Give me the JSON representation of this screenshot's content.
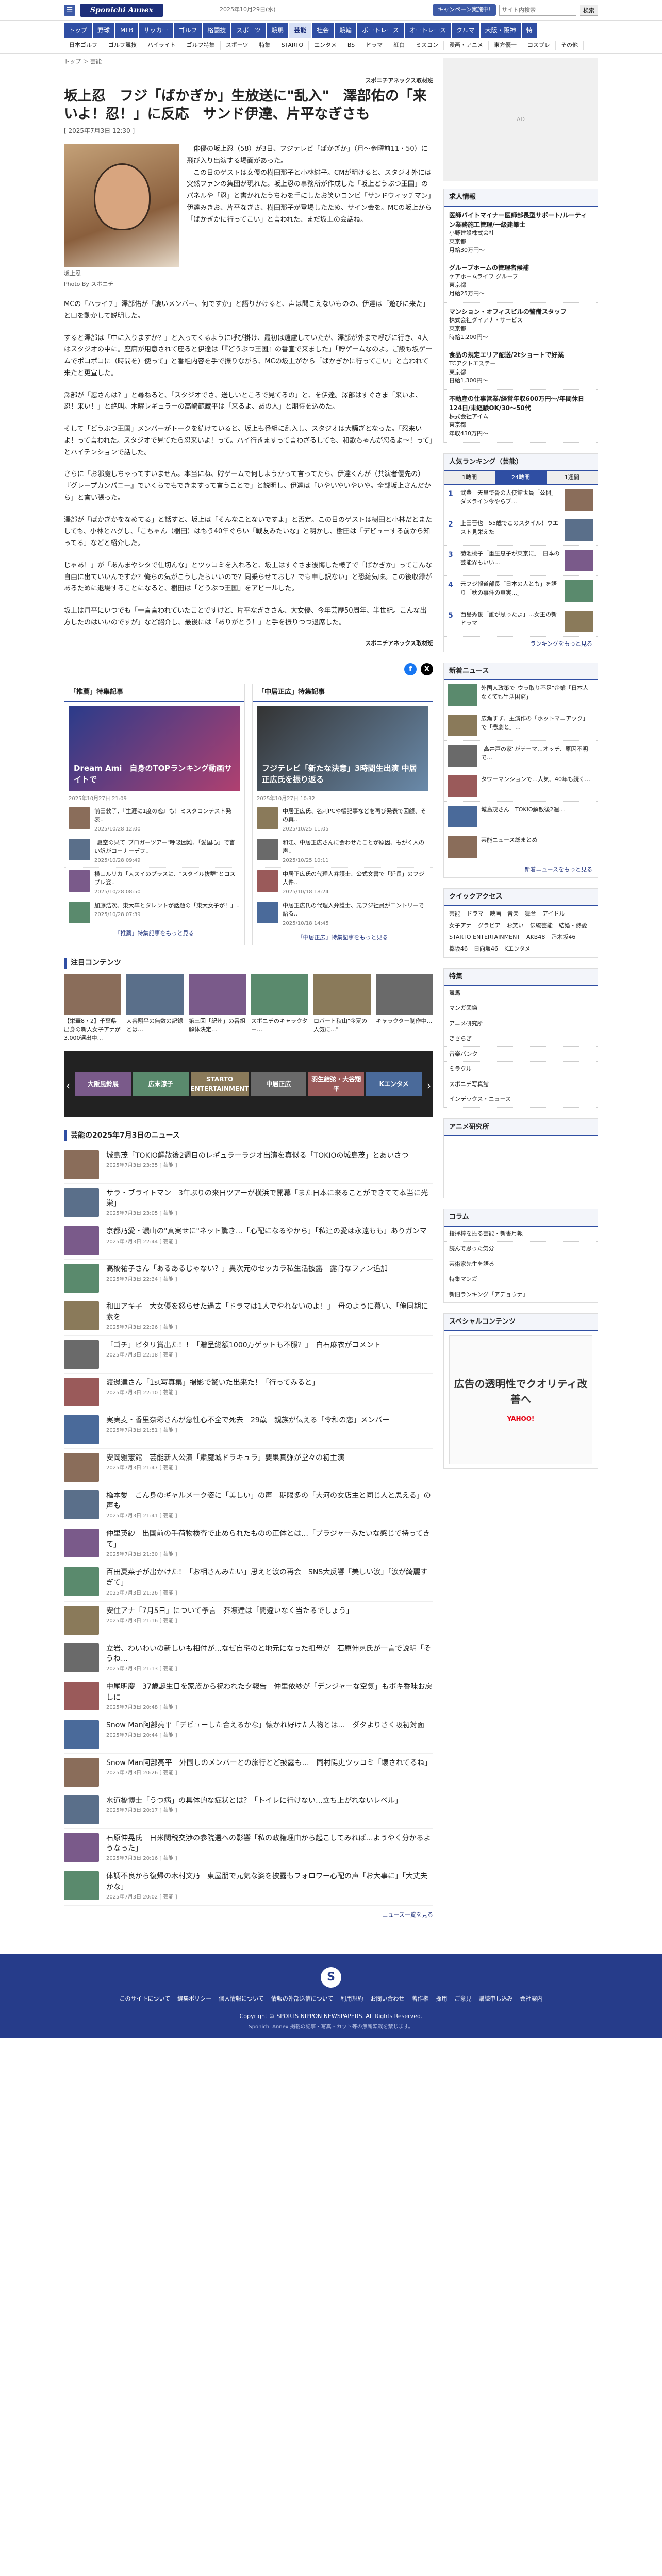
{
  "header": {
    "logo": "Sponichi Annex",
    "date": "2025年10月29日(水)",
    "promo": "キャンペーン実施中!",
    "search_placeholder": "サイト内検索",
    "search_button": "検索",
    "nav": [
      "トップ",
      "野球",
      "MLB",
      "サッカー",
      "ゴルフ",
      "格闘技",
      "スポーツ",
      "競馬",
      "芸能",
      "社会",
      "競輪",
      "ボートレース",
      "オートレース",
      "クルマ",
      "大阪・阪神",
      "特"
    ],
    "nav_active": "芸能",
    "subnav": [
      "日本ゴルフ",
      "ゴルフ競技",
      "ハイライト",
      "ゴルフ特集",
      "スポーツ",
      "特集",
      "STARTO",
      "エンタメ",
      "BS",
      "ドラマ",
      "紅白",
      "ミスコン",
      "漫画・アニメ",
      "東方優一",
      "コスプレ",
      "その他"
    ]
  },
  "article": {
    "breadcrumb": "トップ ＞ 芸能",
    "source": "スポニチアネックス取材班",
    "title": "坂上忍　フジ「ばかぎか」生放送に\"乱入\"　澤部佑の「来いよ！忍！」に反応　サンド伊達、片平なぎさも",
    "date": "[ 2025年7月3日 12:30 ]",
    "photo_caption": "坂上忍",
    "photo_credit": "Photo By スポニチ",
    "lead": "　俳優の坂上忍（58）が3日、フジテレビ「ぱかぎか」（月～金曜前11・50）に飛び入り出演する場面があった。\n　この日のゲストは女優の樹田那子と小林緋子。CMが明けると、スタジオ外には突然ファンの集団が現れた。坂上忍の事務所が作成した「坂上どうぶつ王国」のパネルや「忍」と書かれたうちわを手にしたお笑いコンビ「サンドウィッチマン」伊達みきお、片平なぎさ、樹田那子が登場したため、サイン会を。MCの坂上から「ばかぎかに行ってこい」と言われた、まだ坂上の会話ね。",
    "paragraphs": [
      "MCの「ハライチ」澤部佑が「凄いメンバー、何ですか」と語りかけると、声は聞こえないものの、伊達は「遊びに来た」と口を動かして説明した。",
      "すると澤部は「中に入りますか？」と入ってくるように呼び掛け、最初は遠慮していたが、澤部が外まで呼びに行き、4人はスタジオの中に。座席が用意されて座ると伊達は「『どうぶつ王国』の番宣で来ました」「貯ゲームなのよ。ご飯も坂ゲームでポコポコに（時間を）使って」と番組内容を手で振りながら、MCの坂上がから「ばかぎかに行ってこい」と言われて来たと更宣した。",
      "澤部が「忍さんは？」と尋ねると、「スタジオでさ、送しいところで見てるの」と、を伊達。澤部はすぐさま「来いよ、忍！来い！」と絶叫。木曜レギュラーの高崎範蔵平は「来るよ、あの人」と期待を込めた。",
      "そして「どうぶつ王国」メンバーがトークを続けていると、坂上も番組に乱入し、スタジオは大騒ぎとなった。「忍来いよ！って言われた。スタジオで見てたら忍来いよ！って。ハイ行きますって言わざるしても、和歌ちゃんが忍るよ〜！って」とハイテンションで話した。",
      "さらに「お邪魔しちゃってすいません。本当にね、貯ゲームで何しようかって言ってたら、伊達くんが（共演者優先の）『グレープカンパニー』でいくらでもできますって言うことで」と説明し、伊達は「いやいやいやいや。全部坂上さんだから」と言い張った。",
      "澤部が「ばかぎかをなめてる」と話すと、坂上は「そんなことないですよ」と否定。この日のゲストは樹田と小林だとまたしても、小林とハグし、「こちゃん（樹田）はもう40年ぐらい「戦友みたいな」と明かし、樹田は「デビューする前から知ってる」などと紹介した。",
      "じゃあ！」が「あんまやシタで仕切んな」とツッコミを入れると、坂上はすぐさま後悔した様子で「ばかぎか」ってこんな自由に出ていいんですか？俺らの気がこうしたらいいので？同乗らせておし？でも申し訳ない」と恐縮気味。この後収録があるために退場することになると、樹田は「どうぶつ王国」をアピールした。",
      "坂上は月平にいつでも「一言言われていたことですけど、片平なぎささん、大女優、今年芸歴50周年、半世紀。こんな出方したのはいいのですが」など紹介し、最後には「ありがとう！」と手を振りつつ退席した。"
    ],
    "footer_source": "スポニチアネックス取材班"
  },
  "specials": [
    {
      "title": "「推薦」特集記事",
      "feature": "Dream Ami　自身のTOPランキング動画サイトで",
      "feature_date": "2025年10月27日 21:09",
      "items": [
        {
          "t": "前田敦子、『生涯に1度の恋』も！ミスタコンテスト発表..",
          "d": "2025/10/28 12:00"
        },
        {
          "t": "\"夏空の果て\"ブロガーツアー\"呼吸困難、「愛国心」で言い訳がコーナーデフ..",
          "d": "2025/10/28 09:49"
        },
        {
          "t": "横山ルリカ「大スイのプラスに、\"スタイル抜群\"とコスプレ姿..",
          "d": "2025/10/28 08:50"
        },
        {
          "t": "加藤浩次、東大卒とタレントが話題の「東大女子が！」..",
          "d": "2025/10/28 07:39"
        }
      ],
      "more": "「推薦」特集記事をもっと見る"
    },
    {
      "title": "「中居正広」特集記事",
      "feature": "フジテレビ「新たな決意」3時間生出演 中居正広氏を振り返る",
      "feature_date": "2025年10月27日 10:32",
      "items": [
        {
          "t": "中居正広氏、名刺PCや帳記事などを再び発表で回顧、その真..",
          "d": "2025/10/25 11:05"
        },
        {
          "t": "和江、中居正広さんに会わせたことが原因、もがく人の声..",
          "d": "2025/10/25 10:11"
        },
        {
          "t": "中居正広氏の代理人弁護士、公式文書で「延長」のフジ人件..",
          "d": "2025/10/18 18:24"
        },
        {
          "t": "中居正広氏の代理人弁護士、元フジ社員がエントリーで語る..",
          "d": "2025/10/18 14:45"
        }
      ],
      "more": "「中居正広」特集記事をもっと見る"
    }
  ],
  "attention": {
    "title": "注目コンテンツ",
    "items": [
      "【栄華8・2】千葉県出身の新人女子アナが3,000選出中…",
      "大谷翔平の無数の記録とは…",
      "第三回「紀州」の番組解体決定…",
      "スポニチのキャラクター…",
      "ロバート秋山\"今夏の人気に...\"",
      "キャラクター制作中…"
    ],
    "carousel": [
      "大阪風鈴展",
      "広末涼子",
      "STARTO ENTERTAINMENT",
      "中居正広",
      "羽生結弦・大谷翔平",
      "Kエンタメ"
    ]
  },
  "latest": {
    "title": "芸能の2025年7月3日のニュース",
    "items": [
      {
        "t": "城島茂「TOKIO解散後2週目のレギュラーラジオ出演を真似る「TOKIOの城島茂」とあいさつ",
        "d": "2025年7月3日 23:35 [ 芸能 ]"
      },
      {
        "t": "サラ・ブライトマン　3年ぶりの来日ツアーが横浜で開幕「また日本に来ることができてて本当に光栄」",
        "d": "2025年7月3日 23:05 [ 芸能 ]"
      },
      {
        "t": "京都乃愛・濃山の\"真実せに\"ネット驚き…「心配になるやから」「私達の愛は永遠もも」ありガンマ",
        "d": "2025年7月3日 22:44 [ 芸能 ]"
      },
      {
        "t": "高橋祐子さん「あるあるじゃない？」異次元のセッカラ私生活披露　露骨なファン追加",
        "d": "2025年7月3日 22:34 [ 芸能 ]"
      },
      {
        "t": "和田アキ子　大女優を怒らせた過去「ドラマは1人でやれないのよ！」　母のように慕い、「俺同期に素を",
        "d": "2025年7月3日 22:26 [ 芸能 ]"
      },
      {
        "t": "「ゴチ」ビタリ賞出た！！「贈呈総額1000万ゲットも不服？」　白石麻衣がコメント",
        "d": "2025年7月3日 22:18 [ 芸能 ]"
      },
      {
        "t": "渡邊達さん「1st写真集」撮影で驚いた出来た！「行ってみると」",
        "d": "2025年7月3日 22:10 [ 芸能 ]"
      },
      {
        "t": "実実麦・香里奈彩さんが急性心不全で死去　29歳　親族が伝える「令和の恋」メンバー",
        "d": "2025年7月3日 21:51 [ 芸能 ]"
      },
      {
        "t": "安岡雅憲館　芸能新人公演「粛魔城ドラキュラ」要果真弥が堂々の初主演",
        "d": "2025年7月3日 21:47 [ 芸能 ]"
      },
      {
        "t": "橋本愛　こん身のギャルメーク姿に「美しい」の声　期限多の「大河の女店主と同じ人と思える」の声も",
        "d": "2025年7月3日 21:41 [ 芸能 ]"
      },
      {
        "t": "仲里英紗　出国前の手荷物検査で止められたものの正体とは…「ブラジャーみたいな感じで持ってきて」",
        "d": "2025年7月3日 21:30 [ 芸能 ]"
      },
      {
        "t": "百田夏菜子が出かけた！「お相さんみたい」思えと涙の再会　SNS大反響「美しい涙」「涙が綺麗すぎて」",
        "d": "2025年7月3日 21:26 [ 芸能 ]"
      },
      {
        "t": "安住アナ「7月5日」について予言　芥凛達は「間違いなく当たるでしょう」",
        "d": "2025年7月3日 21:16 [ 芸能 ]"
      },
      {
        "t": "立岩、わいわいの新しいも相付が…なぜ自宅のと地元になった祖母が　石原伸晃氏が一言で説明「そうね…",
        "d": "2025年7月3日 21:13 [ 芸能 ]"
      },
      {
        "t": "中尾明慶　37歳誕生日を家族から祝われた夕報告　仲里依紗が「デンジャーな空気」もボキ香味お戻しに",
        "d": "2025年7月3日 20:48 [ 芸能 ]"
      },
      {
        "t": "Snow Man阿部亮平「デビューした合えるかな」懐かれ好けた人物とは…　ダタよりさく吸初対面",
        "d": "2025年7月3日 20:44 [ 芸能 ]"
      },
      {
        "t": "Snow Man阿部亮平　外国しのメンバーとの旅行とど披露も…　同村陽史ツッコミ「壊されてるね」",
        "d": "2025年7月3日 20:26 [ 芸能 ]"
      },
      {
        "t": "水道橋博士「うつ病」の具体的な症状とは？「トイレに行けない…立ち上がれないレベル」",
        "d": "2025年7月3日 20:17 [ 芸能 ]"
      },
      {
        "t": "石原伸晃氏　日米関税交渉の参院選への影響「私の政権理由から起こしてみれば…ようやく分かるようなった」",
        "d": "2025年7月3日 20:16 [ 芸能 ]"
      },
      {
        "t": "体調不良から復帰の木村文乃　東屋朋で元気な姿を披露もフォロワー心配の声「お大事に」「大丈夫かな」",
        "d": "2025年7月3日 20:02 [ 芸能 ]"
      }
    ],
    "more": "ニュース一覧を見る"
  },
  "sidebar": {
    "jobs_title": "求人情報",
    "jobs": [
      {
        "n": "医師バイトマイナー医師部長型サポート/ルーティン業務施工管理/一級建築士",
        "c": "小野建設株式会社",
        "p": "東京都",
        "s": "月給30万円〜"
      },
      {
        "n": "グループホームの管理者候補",
        "c": "ケアホームライフ グループ",
        "p": "東京都",
        "s": "月給25万円〜"
      },
      {
        "n": "マンション・オフィスビルの警備スタッフ",
        "c": "株式会社ダイアナ・サービス",
        "p": "東京都",
        "s": "時給1,200円〜"
      },
      {
        "n": "食品の規定エリア配送/2tショートで好業",
        "c": "TCアクトエステー",
        "p": "東京都",
        "s": "日給1,300円〜"
      },
      {
        "n": "不動産の仕事営業/経営年収600万円〜/年間休日124日/未経験OK/30〜50代",
        "c": "株式会社アイム",
        "p": "東京都",
        "s": "年収430万円〜"
      }
    ],
    "rank_title": "人気ランキング（芸能）",
    "rank_tabs": [
      "1時間",
      "24時間",
      "1週間"
    ],
    "ranks": [
      "武豊　天皇で骨の大使館世員「公開」　ダメライン今やらブ…",
      "上田晋也　55歳でこのスタイル！ウエスト見栄えた",
      "菊池桃子「重圧息子が東京に」　日本の芸能界もいい…",
      "元フジ報道部長「日本の人とも」を語り「秋の事件の真実…」",
      "西島秀俊「誰が思ったよ」…女王の新ドラマ"
    ],
    "rank_more": "ランキングをもっと見る",
    "news_title": "新着ニュース",
    "news": [
      "外国人政策で\"ウラ取り不足\"企業「日本人なくても生活困窮」",
      "広瀬すず、主演作の「ホットマニアック」で「悲劇と」…",
      "\"高井戸の家\"がテーマ…オッチ、原因不明で…",
      "タワーマンションで…人気、40年も続く…",
      "城島茂さん　TOKIO解散後2週…",
      "芸能ニュース総まとめ"
    ],
    "news_more": "新着ニュースをもっと見る",
    "quick_title": "クイックアクセス",
    "quick": [
      "芸能",
      "ドラマ",
      "映画",
      "音楽",
      "舞台",
      "アイドル",
      "女子アナ",
      "グラビア",
      "お笑い",
      "伝統芸能",
      "結婚・熱愛",
      "STARTO ENTERTAINMENT",
      "AKB48",
      "乃木坂46",
      "欅坂46",
      "日向坂46",
      "Kエンタメ"
    ],
    "feature_title": "特集",
    "features": [
      "競馬",
      "マンガ図鑑",
      "アニメ研究所",
      "きさらぎ",
      "音楽バンク",
      "ミラクル",
      "スポニチ写真館"
    ],
    "feature_more": "インデックス・ニュース",
    "anime_title": "アニメ研究所",
    "column_title": "コラム",
    "columns": [
      "指揮棒を振る芸能・新書月報",
      "読んで思った気分",
      "芸術家先生を語る",
      "特集マンガ",
      "新旧ランキング「アデョウナ」"
    ],
    "ad_title": "スペシャルコンテンツ",
    "ad_text": "広告の透明性でクオリティ改善へ",
    "ad_brand": "YAHOO!"
  },
  "footer": {
    "links": [
      "このサイトについて",
      "編集ポリシー",
      "個人情報について",
      "情報の外部送信について",
      "利用規約",
      "お問い合わせ",
      "著作権",
      "採用",
      "ご意見",
      "購読申し込み",
      "会社案内"
    ],
    "copyright": "Copyright © SPORTS NIPPON NEWSPAPERS. All Rights Reserved.",
    "sub": "Sponichi Annex 掲載の記事・写真・カット等の無断転載を禁じます。"
  }
}
